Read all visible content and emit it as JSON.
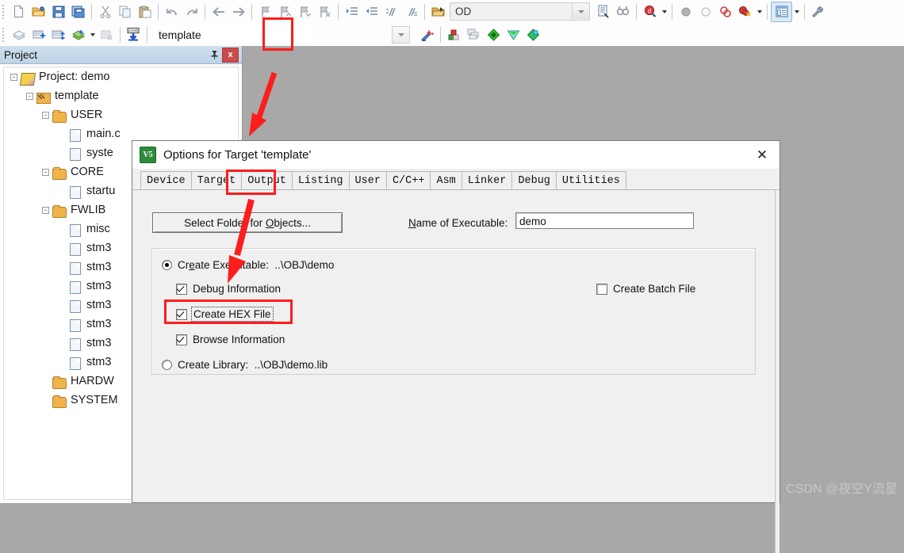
{
  "toolbar": {
    "row1": {
      "buttons": [
        {
          "name": "new-file-icon",
          "glyph": "new"
        },
        {
          "name": "open-file-icon",
          "glyph": "open"
        },
        {
          "name": "save-icon",
          "glyph": "save"
        },
        {
          "name": "save-all-icon",
          "glyph": "saveall"
        },
        {
          "name": "cut-icon",
          "glyph": "cut"
        },
        {
          "name": "copy-icon",
          "glyph": "copy"
        },
        {
          "name": "paste-icon",
          "glyph": "paste"
        },
        {
          "name": "undo-icon",
          "glyph": "undo"
        },
        {
          "name": "redo-icon",
          "glyph": "redo"
        },
        {
          "name": "navigate-back-icon",
          "glyph": "back"
        },
        {
          "name": "navigate-forward-icon",
          "glyph": "forward"
        },
        {
          "name": "bookmark-toggle-icon",
          "glyph": "bm1"
        },
        {
          "name": "bookmark-prev-icon",
          "glyph": "bm2"
        },
        {
          "name": "bookmark-next-icon",
          "glyph": "bm3"
        },
        {
          "name": "bookmark-clear-icon",
          "glyph": "bm4"
        },
        {
          "name": "indent-icon",
          "glyph": "ind1"
        },
        {
          "name": "outdent-icon",
          "glyph": "ind2"
        },
        {
          "name": "comment-icon",
          "glyph": "cmt1"
        },
        {
          "name": "uncomment-icon",
          "glyph": "cmt2"
        },
        {
          "name": "open-folder-icon",
          "glyph": "foldopen"
        }
      ],
      "search_combo_value": "OD",
      "right_buttons": [
        {
          "name": "insert-file-icon",
          "glyph": "doc"
        },
        {
          "name": "find-in-files-icon",
          "glyph": "binoc"
        },
        {
          "name": "debug-find-icon",
          "glyph": "qfind"
        },
        {
          "name": "breakpoint-icon",
          "glyph": "bp1"
        },
        {
          "name": "breakpoint-disable-icon",
          "glyph": "bp2"
        },
        {
          "name": "breakpoint-kill-icon",
          "glyph": "bp3"
        },
        {
          "name": "breakpoint-removeall-icon",
          "glyph": "bp4"
        },
        {
          "name": "window-layout-icon",
          "glyph": "layout"
        },
        {
          "name": "configure-icon",
          "glyph": "wrench"
        }
      ]
    },
    "row2": {
      "buttons": [
        {
          "name": "translate-icon",
          "glyph": "trans"
        },
        {
          "name": "build-icon",
          "glyph": "build"
        },
        {
          "name": "rebuild-icon",
          "glyph": "rebuild"
        },
        {
          "name": "batch-build-icon",
          "glyph": "batch"
        },
        {
          "name": "stop-build-icon",
          "glyph": "stop"
        },
        {
          "name": "download-icon",
          "glyph": "load"
        }
      ],
      "target_combo_value": "template",
      "right_buttons": [
        {
          "name": "target-options-icon",
          "glyph": "wand"
        },
        {
          "name": "manage-components-icon",
          "glyph": "comp"
        },
        {
          "name": "multi-project-icon",
          "glyph": "multi"
        },
        {
          "name": "pack-installer-icon",
          "glyph": "pack1"
        },
        {
          "name": "manage-run-time-icon",
          "glyph": "pack2"
        },
        {
          "name": "select-software-packs-icon",
          "glyph": "pack3"
        }
      ]
    }
  },
  "project_panel": {
    "title": "Project",
    "pin_tooltip": "Auto Hide",
    "close_label": "x",
    "tree": [
      {
        "label": "Project: demo",
        "depth": 0,
        "icon": "project-icon",
        "expander": "-"
      },
      {
        "label": "template",
        "depth": 1,
        "icon": "target-icon",
        "expander": "-"
      },
      {
        "label": "USER",
        "depth": 2,
        "icon": "folder-icon",
        "expander": "-"
      },
      {
        "label": "main.c",
        "depth": 3,
        "icon": "file-icon",
        "expander": ""
      },
      {
        "label": "syste",
        "depth": 3,
        "icon": "file-icon",
        "expander": ""
      },
      {
        "label": "CORE",
        "depth": 2,
        "icon": "folder-icon",
        "expander": "-"
      },
      {
        "label": "startu",
        "depth": 3,
        "icon": "file-icon",
        "expander": ""
      },
      {
        "label": "FWLIB",
        "depth": 2,
        "icon": "folder-icon",
        "expander": "-"
      },
      {
        "label": "misc",
        "depth": 3,
        "icon": "file-icon",
        "expander": ""
      },
      {
        "label": "stm3",
        "depth": 3,
        "icon": "file-icon",
        "expander": ""
      },
      {
        "label": "stm3",
        "depth": 3,
        "icon": "file-icon",
        "expander": ""
      },
      {
        "label": "stm3",
        "depth": 3,
        "icon": "file-icon",
        "expander": ""
      },
      {
        "label": "stm3",
        "depth": 3,
        "icon": "file-icon",
        "expander": ""
      },
      {
        "label": "stm3",
        "depth": 3,
        "icon": "file-icon",
        "expander": ""
      },
      {
        "label": "stm3",
        "depth": 3,
        "icon": "file-icon",
        "expander": ""
      },
      {
        "label": "stm3",
        "depth": 3,
        "icon": "file-icon",
        "expander": ""
      },
      {
        "label": "HARDW",
        "depth": 2,
        "icon": "folder-icon",
        "expander": ""
      },
      {
        "label": "SYSTEM",
        "depth": 2,
        "icon": "folder-icon",
        "expander": ""
      }
    ]
  },
  "dialog": {
    "icon_text": "V5",
    "title": "Options for Target 'template'",
    "close_label": "✕",
    "tabs": [
      {
        "label": "Device",
        "active": false
      },
      {
        "label": "Target",
        "active": false
      },
      {
        "label": "Output",
        "active": true
      },
      {
        "label": "Listing",
        "active": false
      },
      {
        "label": "User",
        "active": false
      },
      {
        "label": "C/C++",
        "active": false
      },
      {
        "label": "Asm",
        "active": false
      },
      {
        "label": "Linker",
        "active": false
      },
      {
        "label": "Debug",
        "active": false
      },
      {
        "label": "Utilities",
        "active": false
      }
    ],
    "select_folder_button": "Select Folder for Objects...",
    "name_of_executable_label": "Name of Executable:",
    "name_of_executable_value": "demo",
    "create_executable": {
      "label": "Create Executable:",
      "path": "..\\OBJ\\demo",
      "checked": true
    },
    "create_library": {
      "label": "Create Library:",
      "path": "..\\OBJ\\demo.lib",
      "checked": false
    },
    "checkboxes": [
      {
        "label": "Debug Information",
        "checked": true,
        "name": "debug-information-checkbox"
      },
      {
        "label": "Create HEX File",
        "checked": true,
        "name": "create-hex-file-checkbox"
      },
      {
        "label": "Browse Information",
        "checked": true,
        "name": "browse-information-checkbox"
      }
    ],
    "create_batch_file": {
      "label": "Create Batch File",
      "checked": false
    }
  },
  "annotations": {
    "highlight_color": "#fc1d1d",
    "boxes": [
      {
        "name": "toolbar-target-options-highlight"
      },
      {
        "name": "output-tab-highlight"
      },
      {
        "name": "create-hex-file-highlight"
      }
    ],
    "arrows": [
      {
        "name": "arrow-to-project-area"
      },
      {
        "name": "arrow-output-to-hex"
      }
    ]
  },
  "watermark": "CSDN @夜空Y流星"
}
